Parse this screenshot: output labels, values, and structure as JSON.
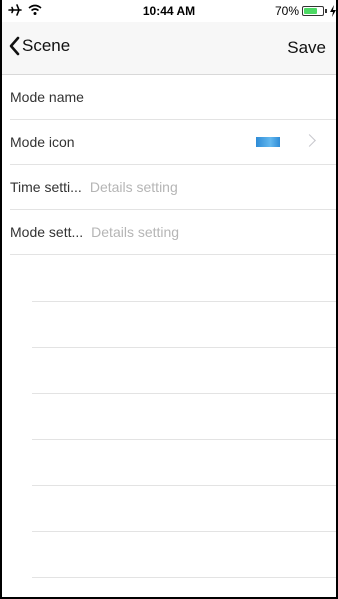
{
  "status_bar": {
    "time": "10:44 AM",
    "battery_percent_text": "70%",
    "battery_level": 0.7,
    "battery_color": "#4cd964",
    "icons": [
      "airplane-icon",
      "wifi-icon",
      "battery-icon",
      "charging-icon"
    ]
  },
  "nav": {
    "back_label": "Scene",
    "save_label": "Save"
  },
  "rows": [
    {
      "label": "Mode name",
      "value": ""
    },
    {
      "label": "Mode icon",
      "value": ""
    },
    {
      "label": "Time setti...",
      "value": "Details setting"
    },
    {
      "label": "Mode sett...",
      "value": "Details setting"
    }
  ],
  "colors": {
    "nav_background": "#f7f7f7",
    "separator": "#e3e3e3",
    "placeholder_text": "#b5b5b5",
    "mode_icon_blue": "#2e8bd6"
  }
}
